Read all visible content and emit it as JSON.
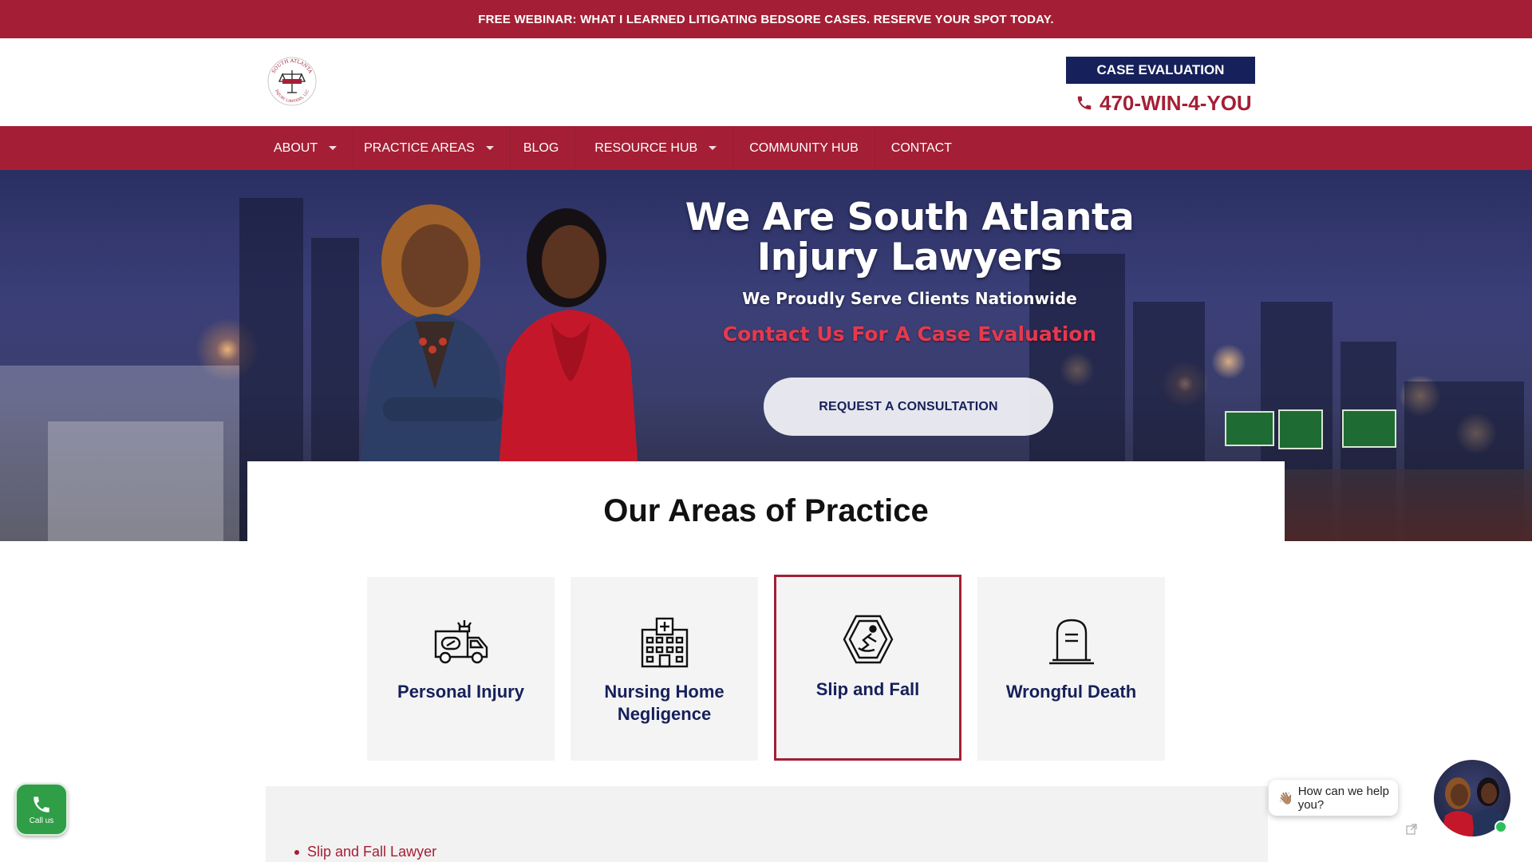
{
  "banner": {
    "text": "FREE WEBINAR: WHAT I LEARNED LITIGATING BEDSORE CASES. RESERVE YOUR SPOT TODAY."
  },
  "header": {
    "logo_icon": "scales-of-justice-logo",
    "logo_text_top": "SOUTH ATLANTA",
    "logo_text_bottom": "INJURY LAWYERS, LLC",
    "case_evaluation_label": "CASE EVALUATION",
    "phone_icon": "phone-icon",
    "phone_number": "470-WIN-4-YOU"
  },
  "nav": {
    "items": [
      {
        "label": "ABOUT",
        "has_dropdown": true
      },
      {
        "label": "PRACTICE AREAS",
        "has_dropdown": true
      },
      {
        "label": "BLOG",
        "has_dropdown": false
      },
      {
        "label": "RESOURCE HUB",
        "has_dropdown": true
      },
      {
        "label": "COMMUNITY HUB",
        "has_dropdown": false
      },
      {
        "label": "CONTACT",
        "has_dropdown": false
      }
    ]
  },
  "hero": {
    "title_line1": "We Are South Atlanta",
    "title_line2": "Injury Lawyers",
    "subtitle": "We Proudly Serve Clients Nationwide",
    "cta_text": "Contact Us For A Case Evaluation",
    "button_label": "REQUEST A CONSULTATION"
  },
  "practice": {
    "title": "Our Areas of Practice",
    "cards": [
      {
        "label": "Personal Injury",
        "icon": "ambulance-icon",
        "active": false
      },
      {
        "label": "Nursing Home Negligence",
        "icon": "hospital-building-icon",
        "active": false
      },
      {
        "label": "Slip and Fall",
        "icon": "slip-fall-hazard-icon",
        "active": true
      },
      {
        "label": "Wrongful Death",
        "icon": "tombstone-icon",
        "active": false
      }
    ]
  },
  "lower": {
    "list_item": "Slip and Fall Lawyer"
  },
  "floating": {
    "call_label": "Call us",
    "chat_prompt": "How can we help you?",
    "chat_emoji": "👋🏽"
  },
  "colors": {
    "brand_red": "#a41f35",
    "navy": "#16205a",
    "call_green": "#2f9e47"
  }
}
